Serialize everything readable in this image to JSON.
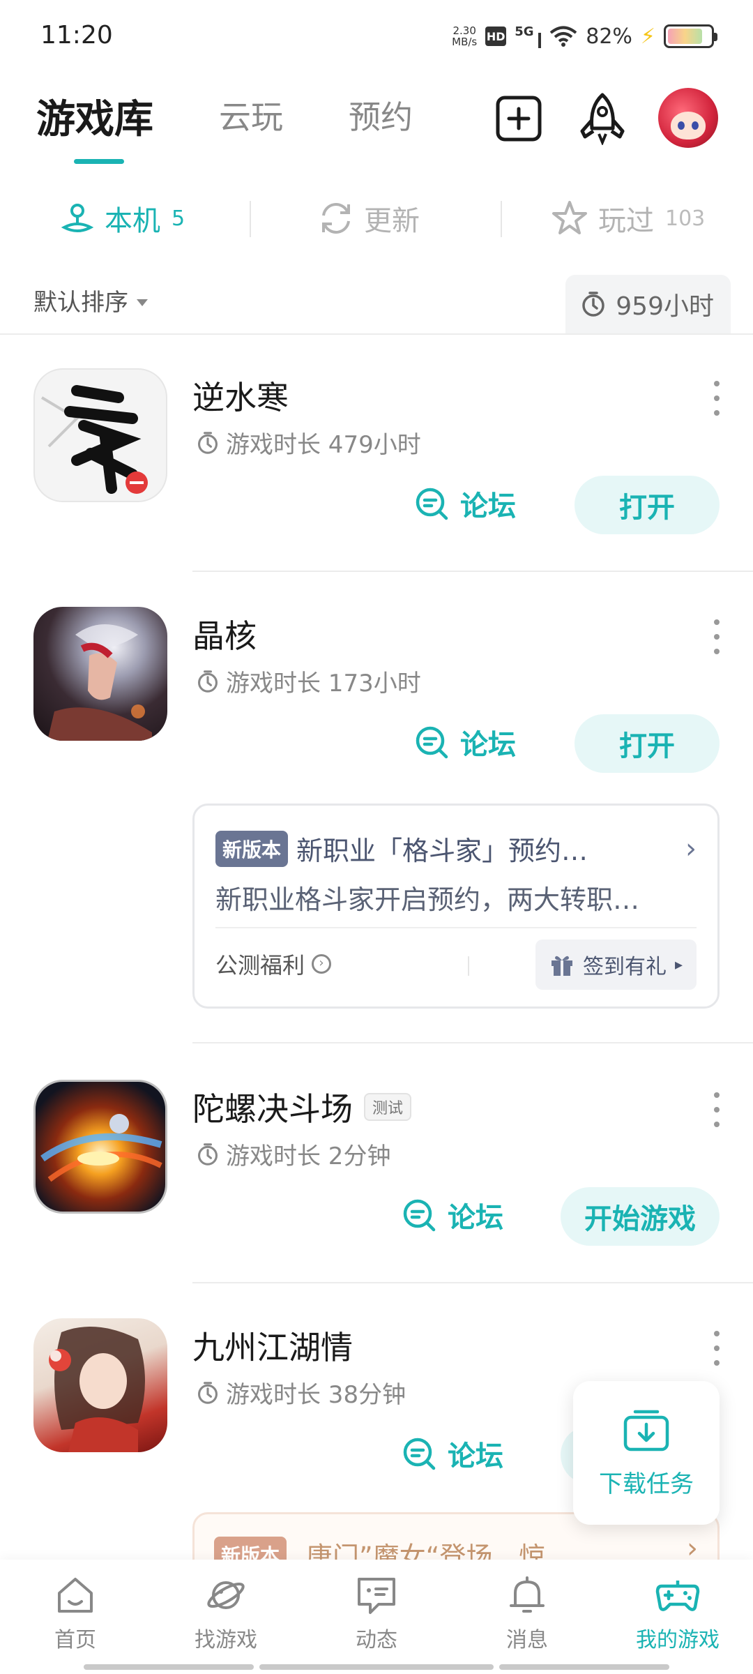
{
  "status_bar": {
    "time": "11:20",
    "speed_value": "2.30",
    "speed_unit": "MB/s",
    "hd": "HD",
    "network": "5G",
    "battery": "82%"
  },
  "header": {
    "tabs": [
      "游戏库",
      "云玩",
      "预约"
    ],
    "active_tab": "游戏库"
  },
  "sub_tabs": {
    "local": {
      "label": "本机",
      "count": "5"
    },
    "update": {
      "label": "更新"
    },
    "played": {
      "label": "玩过",
      "count": "103"
    }
  },
  "sort": {
    "label": "默认排序",
    "total_hours": "959小时"
  },
  "games": [
    {
      "name": "逆水寒",
      "time": "游戏时长 479小时",
      "forum": "论坛",
      "action": "打开"
    },
    {
      "name": "晶核",
      "time": "游戏时长 173小时",
      "forum": "论坛",
      "action": "打开"
    },
    {
      "name": "陀螺决斗场",
      "tag": "测试",
      "time": "游戏时长 2分钟",
      "forum": "论坛",
      "action": "开始游戏"
    },
    {
      "name": "九州江湖情",
      "time": "游戏时长 38分钟",
      "forum": "论坛"
    }
  ],
  "update_card": {
    "badge": "新版本",
    "title": "新职业「格斗家」预约…",
    "desc": "新职业格斗家开启预约，两大转职…",
    "welfare": "公测福利",
    "sign": "签到有礼"
  },
  "partial_card": {
    "badge": "新版本",
    "title": "唐门”魔女“登场，惊…"
  },
  "download_task": "下载任务",
  "bottom_nav": [
    "首页",
    "找游戏",
    "动态",
    "消息",
    "我的游戏"
  ],
  "colors": {
    "accent": "#1ab3b3",
    "badge": "#6a7593"
  }
}
